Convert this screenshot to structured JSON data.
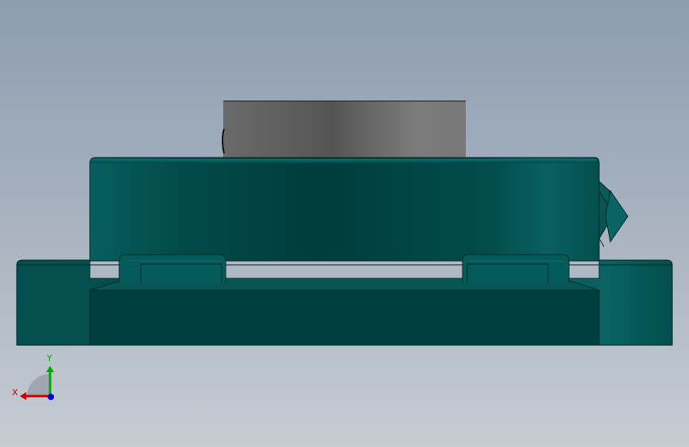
{
  "viewport": {
    "background_top": "#8d9db0",
    "background_bottom": "#c6ccd2"
  },
  "model": {
    "body_color": "#004a4a",
    "bearing_insert_color": "#6e6e6e",
    "grease_fitting": "grease-nipple"
  },
  "triad": {
    "x_label": "X",
    "y_label": "Y",
    "x_color": "#cc0000",
    "y_color": "#00aa00",
    "z_color": "#0000dd"
  }
}
